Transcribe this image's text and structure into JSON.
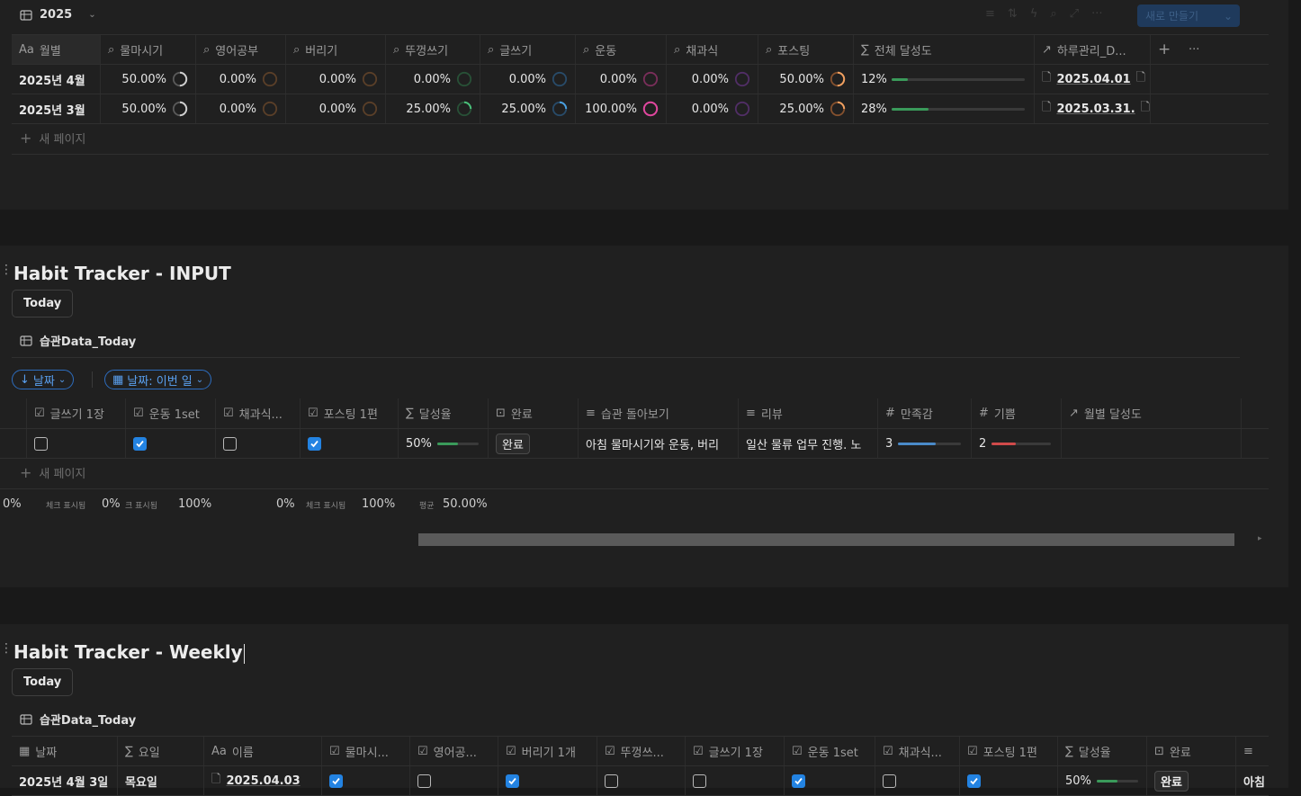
{
  "top": {
    "view_title": "2025",
    "new_button": "새로 만들기",
    "columns": [
      "월별",
      "물마시기",
      "영어공부",
      "버리기",
      "뚜껑쓰기",
      "글쓰기",
      "운동",
      "채과식",
      "포스팅",
      "전체 달성도",
      "하루관리_D..."
    ],
    "col_prefix": {
      "name": "Aa",
      "sum": "∑"
    },
    "rows": [
      {
        "month": "2025년 4월",
        "vals": [
          "50.00%",
          "0.00%",
          "0.00%",
          "0.00%",
          "0.00%",
          "0.00%",
          "0.00%",
          "50.00%"
        ],
        "pct": [
          50,
          0,
          0,
          0,
          0,
          0,
          0,
          50
        ],
        "overall": "12%",
        "overall_pct": 12,
        "link": "2025.04.01"
      },
      {
        "month": "2025년 3월",
        "vals": [
          "50.00%",
          "0.00%",
          "0.00%",
          "25.00%",
          "25.00%",
          "100.00%",
          "0.00%",
          "25.00%"
        ],
        "pct": [
          50,
          0,
          0,
          25,
          25,
          100,
          0,
          25
        ],
        "overall": "28%",
        "overall_pct": 28,
        "link": "2025.03.31."
      }
    ],
    "ring_colors": [
      "#8a8a8a",
      "#8a5a2f",
      "#8a5a2f",
      "#2f7a4a",
      "#2f6fa6",
      "#c43b8a",
      "#7a3ba0",
      "#d97a3a"
    ],
    "new_page": "새 페이지"
  },
  "input": {
    "title": "Habit Tracker - INPUT",
    "today_button": "Today",
    "db_name": "습관Data_Today",
    "sort_chip": "날짜",
    "filter_chip": "날짜: 이번 일",
    "columns": [
      "글쓰기 1장",
      "운동 1set",
      "채과식...",
      "포스팅 1편",
      "달성율",
      "완료",
      "습관 돌아보기",
      "리뷰",
      "만족감",
      "기쁨",
      "월별 달성도"
    ],
    "row": {
      "checks": [
        false,
        true,
        false,
        true
      ],
      "rate": "50%",
      "rate_pct": 50,
      "done": "완료",
      "reflect": "아침 물마시기와 운동, 버리",
      "review": "일산 물류 업무 진행. 노",
      "satisfaction": "3",
      "satisfaction_frac": 0.6,
      "joy": "2",
      "joy_frac": 0.4
    },
    "new_page": "새 페이지",
    "footer": {
      "a": "0%",
      "b_label": "체크 표시됨",
      "b": "0%",
      "c_label": "크 표시됨",
      "c": "100%",
      "d": "0%",
      "e_label": "체크 표시됨",
      "e": "100%",
      "f_label": "평균",
      "f": "50.00%"
    }
  },
  "weekly": {
    "title": "Habit Tracker - Weekly",
    "today_button": "Today",
    "db_name": "습관Data_Today",
    "columns": [
      "날짜",
      "요일",
      "이름",
      "물마시...",
      "영어공...",
      "버리기 1개",
      "뚜껑쓰...",
      "글쓰기 1장",
      "운동 1set",
      "채과식...",
      "포스팅 1편",
      "달성율",
      "완료"
    ],
    "row": {
      "date": "2025년 4월 3일",
      "weekday": "목요일",
      "name": "2025.04.03",
      "checks": [
        true,
        false,
        true,
        false,
        false,
        true,
        false,
        true
      ],
      "rate": "50%",
      "rate_pct": 50,
      "done": "완료",
      "extra": "아침"
    }
  }
}
